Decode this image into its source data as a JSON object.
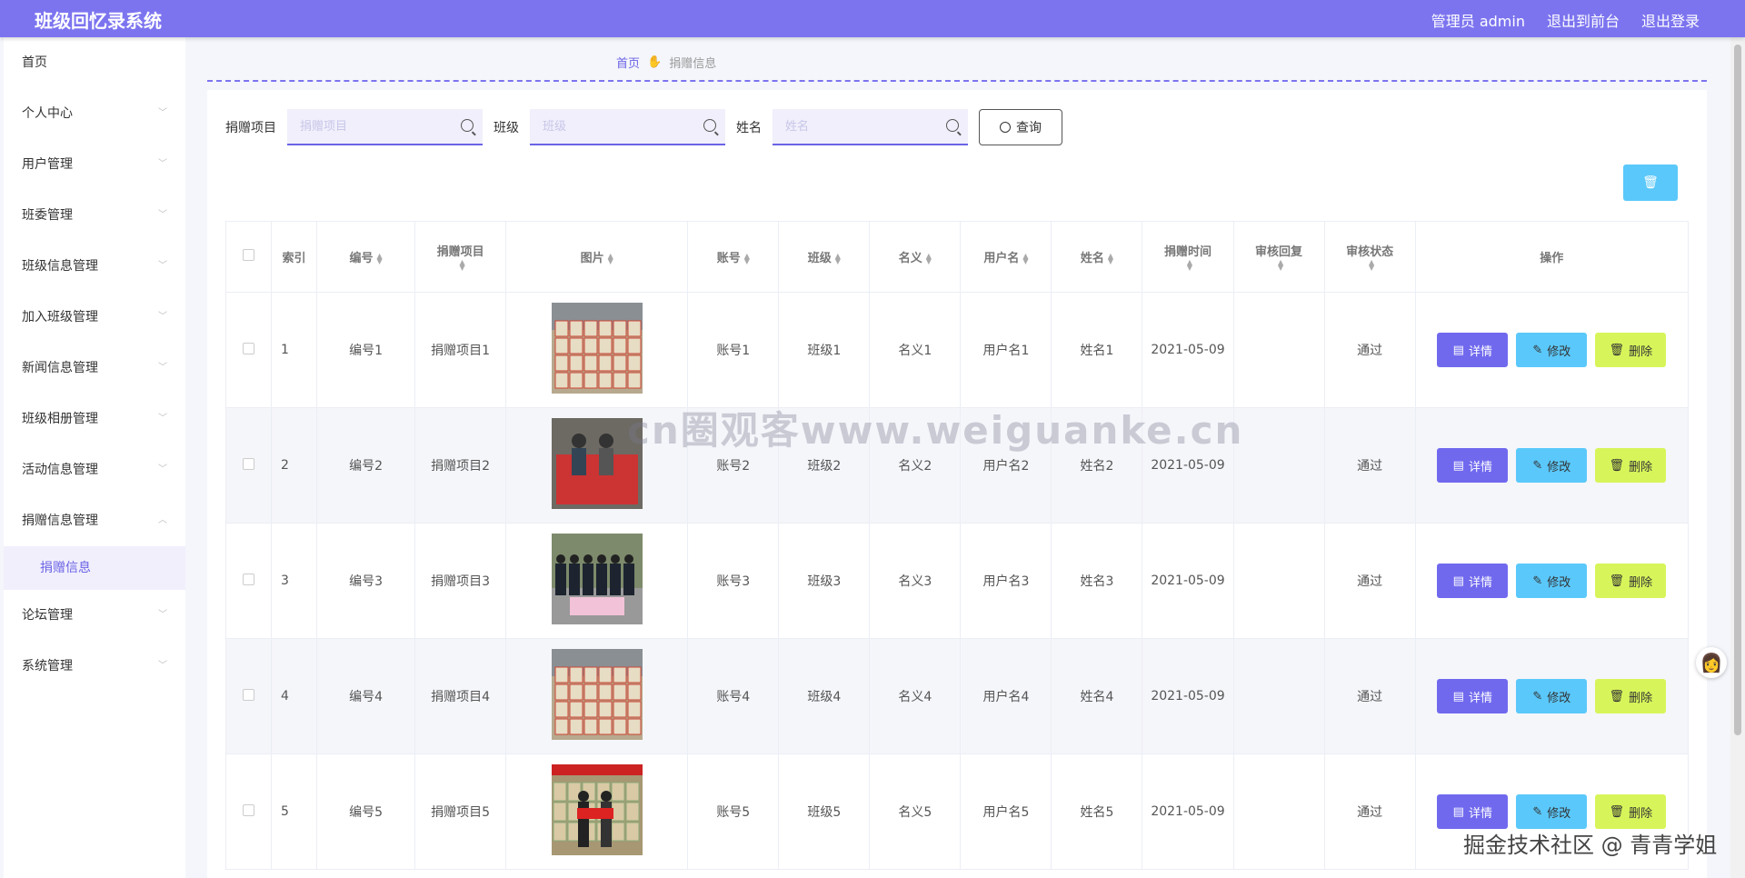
{
  "header": {
    "title": "班级回忆录系统",
    "admin": "管理员 admin",
    "to_front": "退出到前台",
    "logout": "退出登录"
  },
  "sidebar": {
    "items": [
      {
        "label": "首页",
        "chevron": false
      },
      {
        "label": "个人中心",
        "chevron": true
      },
      {
        "label": "用户管理",
        "chevron": true
      },
      {
        "label": "班委管理",
        "chevron": true
      },
      {
        "label": "班级信息管理",
        "chevron": true
      },
      {
        "label": "加入班级管理",
        "chevron": true
      },
      {
        "label": "新闻信息管理",
        "chevron": true
      },
      {
        "label": "班级相册管理",
        "chevron": true
      },
      {
        "label": "活动信息管理",
        "chevron": true
      },
      {
        "label": "捐赠信息管理",
        "chevron": true,
        "expanded": true
      }
    ],
    "sub_item": "捐赠信息",
    "items_after": [
      {
        "label": "论坛管理",
        "chevron": true
      },
      {
        "label": "系统管理",
        "chevron": true
      }
    ]
  },
  "breadcrumb": {
    "home": "首页",
    "current": "捐赠信息"
  },
  "search": {
    "project_label": "捐赠项目",
    "project_placeholder": "捐赠项目",
    "class_label": "班级",
    "class_placeholder": "班级",
    "name_label": "姓名",
    "name_placeholder": "姓名",
    "query_label": "查询"
  },
  "table": {
    "headers": [
      "索引",
      "编号",
      "捐赠项目",
      "图片",
      "账号",
      "班级",
      "名义",
      "用户名",
      "姓名",
      "捐赠时间",
      "审核回复",
      "审核状态",
      "操作"
    ],
    "rows": [
      {
        "index": "1",
        "code": "编号1",
        "project": "捐赠项目1",
        "account": "账号1",
        "class": "班级1",
        "title": "名义1",
        "username": "用户名1",
        "name": "姓名1",
        "time": "2021-05-09",
        "reply": "",
        "status": "通过"
      },
      {
        "index": "2",
        "code": "编号2",
        "project": "捐赠项目2",
        "account": "账号2",
        "class": "班级2",
        "title": "名义2",
        "username": "用户名2",
        "name": "姓名2",
        "time": "2021-05-09",
        "reply": "",
        "status": "通过"
      },
      {
        "index": "3",
        "code": "编号3",
        "project": "捐赠项目3",
        "account": "账号3",
        "class": "班级3",
        "title": "名义3",
        "username": "用户名3",
        "name": "姓名3",
        "time": "2021-05-09",
        "reply": "",
        "status": "通过"
      },
      {
        "index": "4",
        "code": "编号4",
        "project": "捐赠项目4",
        "account": "账号4",
        "class": "班级4",
        "title": "名义4",
        "username": "用户名4",
        "name": "姓名4",
        "time": "2021-05-09",
        "reply": "",
        "status": "通过"
      },
      {
        "index": "5",
        "code": "编号5",
        "project": "捐赠项目5",
        "account": "账号5",
        "class": "班级5",
        "title": "名义5",
        "username": "用户名5",
        "name": "姓名5",
        "time": "2021-05-09",
        "reply": "",
        "status": "通过"
      }
    ],
    "actions": {
      "detail": "详情",
      "edit": "修改",
      "delete": "删除"
    }
  },
  "watermarks": {
    "center": "cn圈观客www.weiguanke.cn",
    "corner": "掘金技术社区 @ 青青学姐"
  },
  "colors": {
    "primary": "#7c74ef",
    "detail": "#7069ee",
    "edit": "#5ac8fa",
    "delete": "#d7f55a"
  }
}
